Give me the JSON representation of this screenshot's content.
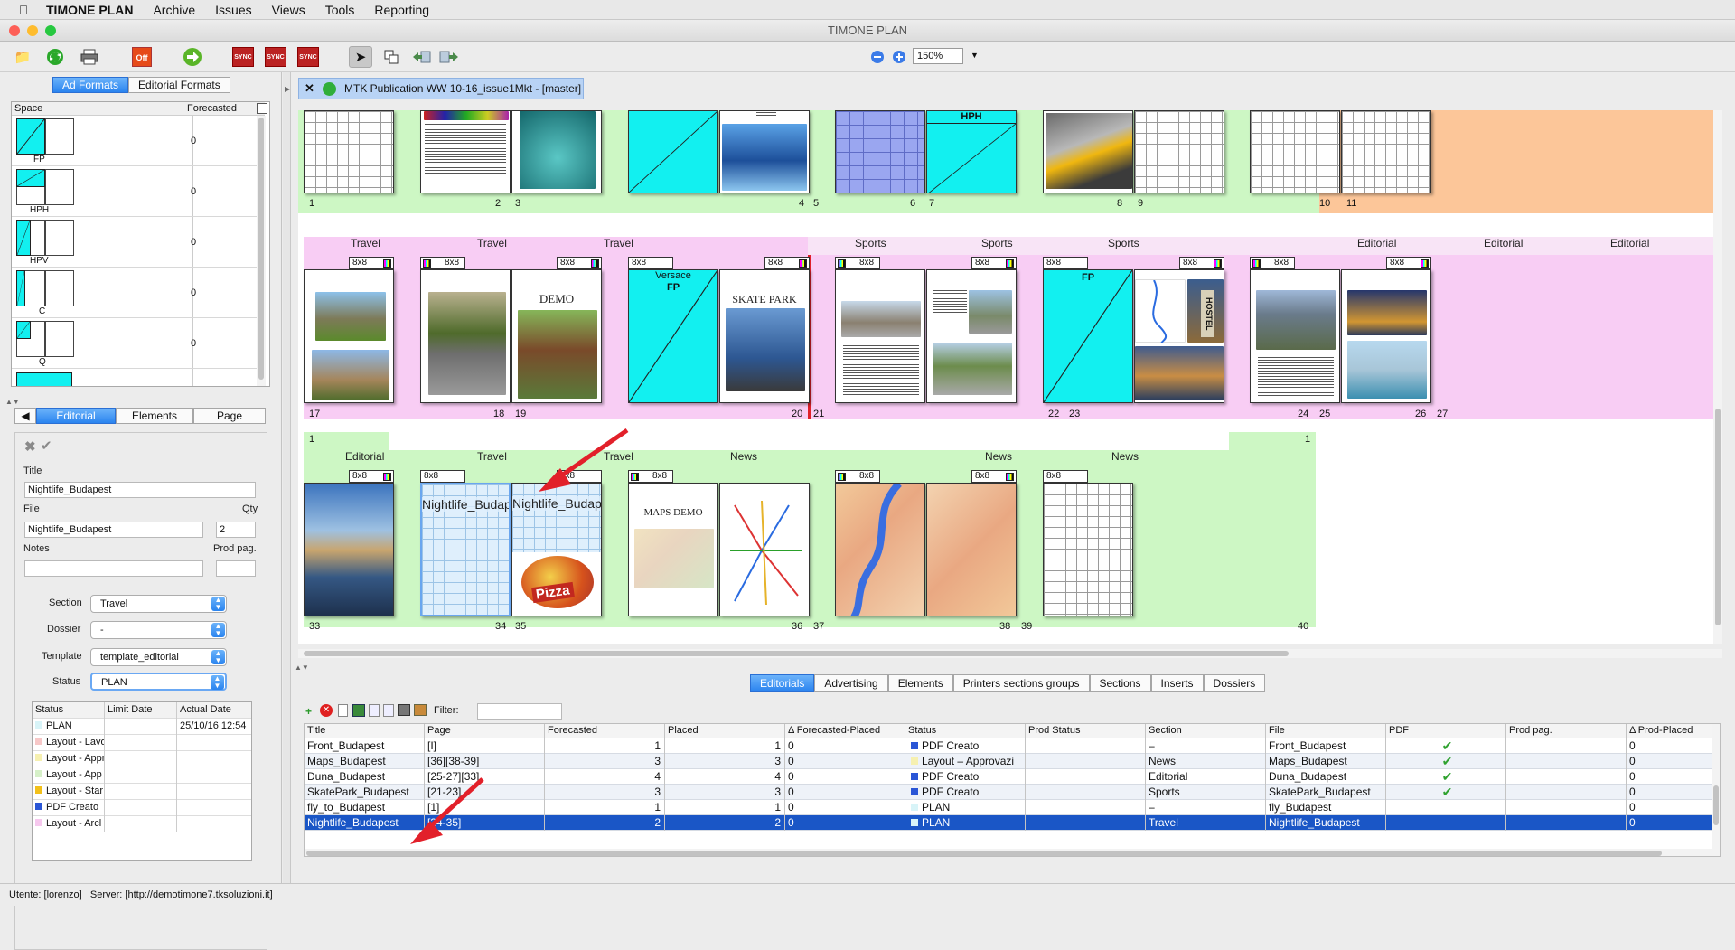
{
  "menubar": {
    "app": "TIMONE PLAN",
    "items": [
      "Archive",
      "Issues",
      "Views",
      "Tools",
      "Reporting"
    ]
  },
  "window": {
    "title": "TIMONE PLAN"
  },
  "toolbar": {
    "zoom": "150%",
    "off_label": "Off",
    "sync_label": "SYNC"
  },
  "left": {
    "tabs": [
      "Ad Formats",
      "Editorial Formats"
    ],
    "formats_header": [
      "Space",
      "Forecasted"
    ],
    "formats": [
      {
        "name": "FP",
        "value": "0"
      },
      {
        "name": "HPH",
        "value": "0"
      },
      {
        "name": "HPV",
        "value": "0"
      },
      {
        "name": "C",
        "value": "0"
      },
      {
        "name": "Q",
        "value": "0"
      }
    ],
    "lower_tabs": [
      "Editorial",
      "Elements",
      "Page"
    ],
    "form": {
      "title_label": "Title",
      "title": "Nightlife_Budapest",
      "file_label": "File",
      "file": "Nightlife_Budapest",
      "qty_label": "Qty",
      "qty": "2",
      "notes_label": "Notes",
      "notes": "",
      "prodpag_label": "Prod pag.",
      "prodpag": "",
      "section_label": "Section",
      "section": "Travel",
      "dossier_label": "Dossier",
      "dossier": "-",
      "template_label": "Template",
      "template": "template_editorial",
      "status_label": "Status",
      "status": "PLAN"
    },
    "status_table": {
      "headers": [
        "Status",
        "Limit Date",
        "Actual Date"
      ],
      "rows": [
        {
          "name": "PLAN",
          "color": "#d8f4f8",
          "actual": "25/10/16 12:54"
        },
        {
          "name": "Layout - Lavo",
          "color": "#f7c8c8",
          "actual": ""
        },
        {
          "name": "Layout - Appr",
          "color": "#f6f0b0",
          "actual": ""
        },
        {
          "name": "Layout - App",
          "color": "#d6f0c8",
          "actual": ""
        },
        {
          "name": "Layout - Star",
          "color": "#f2c01a",
          "actual": ""
        },
        {
          "name": "PDF Creato",
          "color": "#2a56d6",
          "actual": ""
        },
        {
          "name": "Layout - Arcl",
          "color": "#f6c8ee",
          "actual": ""
        }
      ]
    }
  },
  "doc": {
    "tab_title": "MTK Publication WW 10-16_issue1Mkt - [master]"
  },
  "board": {
    "page_numbers": [
      "1",
      "2",
      "3",
      "4",
      "5",
      "6",
      "7",
      "8",
      "9",
      "10",
      "11",
      "17",
      "18",
      "19",
      "20",
      "21",
      "22",
      "23",
      "24",
      "25",
      "26",
      "27",
      "33",
      "34",
      "35",
      "36",
      "37",
      "38",
      "39",
      "40"
    ],
    "sections_row2": [
      "Travel",
      "Travel",
      "Travel",
      "Sports",
      "Sports",
      "Sports",
      "Editorial",
      "Editorial",
      "Editorial"
    ],
    "sections_row3": [
      "Editorial",
      "Travel",
      "Travel",
      "News",
      "News",
      "News"
    ],
    "badge": "8x8",
    "hph": "HPH",
    "fp": "FP",
    "versace": "Versace",
    "skatepark": "SKATE PARK",
    "demo": "DEMO",
    "maps_demo": "MAPS DEMO",
    "hostel": "HOSTEL",
    "pizza": "Pizza",
    "nightlife": "Nightlife_Budapest",
    "row3_marker_left": "1",
    "row3_marker_right": "1"
  },
  "bottom_tabs": [
    "Editorials",
    "Advertising",
    "Elements",
    "Printers sections groups",
    "Sections",
    "Inserts",
    "Dossiers"
  ],
  "filter_label": "Filter:",
  "table": {
    "headers": [
      "Title",
      "Page",
      "Forecasted",
      "Placed",
      "Δ Forecasted-Placed",
      "Status",
      "Prod Status",
      "Section",
      "File",
      "PDF",
      "Prod pag.",
      "Δ Prod-Placed"
    ],
    "rows": [
      {
        "title": "Front_Budapest",
        "page": "[I]",
        "forecasted": "1",
        "placed": "1",
        "delta": "0",
        "status": "PDF Creato",
        "status_color": "#2a56d6",
        "prod_status": "",
        "section": "–",
        "file": "Front_Budapest",
        "pdf": "✔",
        "prodpag": "",
        "delta2": "0"
      },
      {
        "title": "Maps_Budapest",
        "page": "[36][38-39]",
        "forecasted": "3",
        "placed": "3",
        "delta": "0",
        "status": "Layout – Approvazi",
        "status_color": "#f6f0b0",
        "prod_status": "",
        "section": "News",
        "file": "Maps_Budapest",
        "pdf": "✔",
        "prodpag": "",
        "delta2": "0"
      },
      {
        "title": "Duna_Budapest",
        "page": "[25-27][33]",
        "forecasted": "4",
        "placed": "4",
        "delta": "0",
        "status": "PDF Creato",
        "status_color": "#2a56d6",
        "prod_status": "",
        "section": "Editorial",
        "file": "Duna_Budapest",
        "pdf": "✔",
        "prodpag": "",
        "delta2": "0"
      },
      {
        "title": "SkatePark_Budapest",
        "page": "[21-23]",
        "forecasted": "3",
        "placed": "3",
        "delta": "0",
        "status": "PDF Creato",
        "status_color": "#2a56d6",
        "prod_status": "",
        "section": "Sports",
        "file": "SkatePark_Budapest",
        "pdf": "✔",
        "prodpag": "",
        "delta2": "0"
      },
      {
        "title": "fly_to_Budapest",
        "page": "[1]",
        "forecasted": "1",
        "placed": "1",
        "delta": "0",
        "status": "PLAN",
        "status_color": "#d8f4f8",
        "prod_status": "",
        "section": "–",
        "file": "fly_Budapest",
        "pdf": "",
        "prodpag": "",
        "delta2": "0"
      },
      {
        "title": "Nightlife_Budapest",
        "page": "[34-35]",
        "forecasted": "2",
        "placed": "2",
        "delta": "0",
        "status": "PLAN",
        "status_color": "#d8f4f8",
        "prod_status": "",
        "section": "Travel",
        "file": "Nightlife_Budapest",
        "pdf": "",
        "prodpag": "",
        "delta2": "0"
      }
    ]
  },
  "statusbar": {
    "user": "Utente: [lorenzo]",
    "server": "Server: [http://demotimone7.tksoluzioni.it]"
  },
  "colors": {
    "green_band": "#cdf7c4",
    "pink_band": "#f8cdf4",
    "orange_band": "#fcc699",
    "cyan": "#12f0f0",
    "selection": "#1a56c6"
  }
}
